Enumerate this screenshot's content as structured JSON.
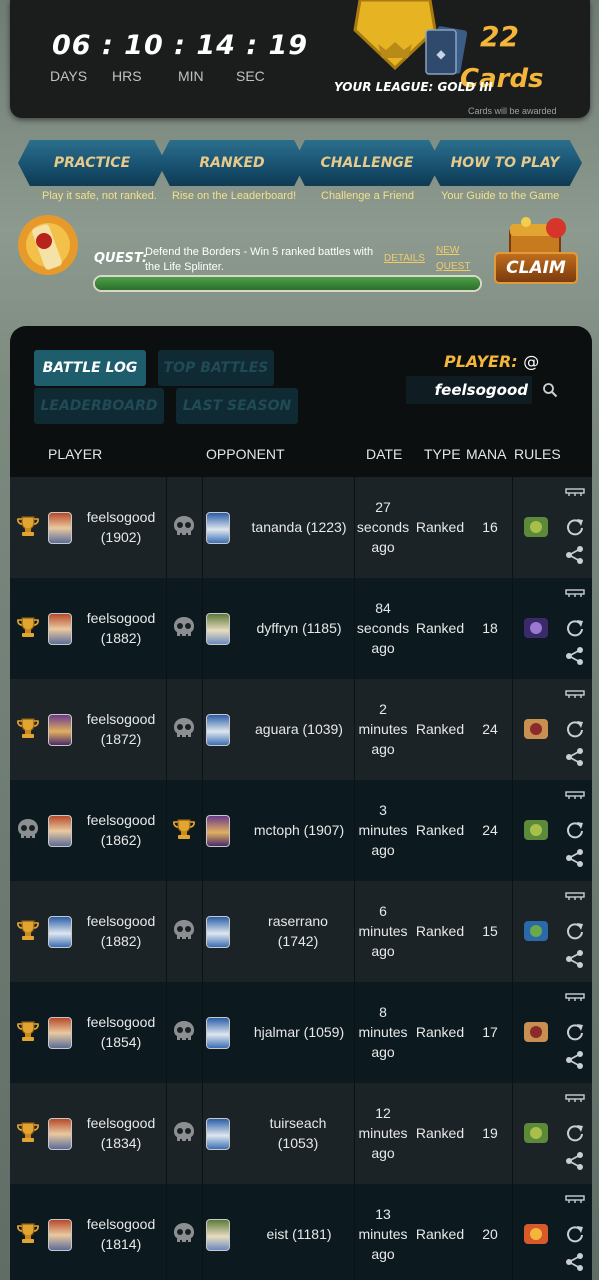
{
  "timer": {
    "digits": "06 : 10 : 14 : 19",
    "days": "DAYS",
    "hrs": "HRS",
    "min": "MIN",
    "sec": "SEC"
  },
  "league": {
    "label": "YOUR LEAGUE: GOLD III",
    "cards_count": "22",
    "cards_word": "Cards",
    "note": "Cards will be awarded"
  },
  "nav": [
    {
      "label": "PRACTICE",
      "sub": "Play it safe, not ranked."
    },
    {
      "label": "RANKED",
      "sub": "Rise on the Leaderboard!"
    },
    {
      "label": "CHALLENGE",
      "sub": "Challenge a Friend"
    },
    {
      "label": "HOW TO PLAY",
      "sub": "Your Guide to the Game"
    }
  ],
  "quest": {
    "title": "QUEST:",
    "desc": "Defend the Borders - Win 5 ranked battles with the Life Splinter.",
    "details": "DETAILS",
    "new": "NEW",
    "quest_word": "QUEST",
    "claim": "CLAIM",
    "progress": 1.0
  },
  "tabs": {
    "battle_log": "BATTLE LOG",
    "top_battles": "TOP BATTLES",
    "leaderboard": "LEADERBOARD",
    "last_season": "LAST SEASON"
  },
  "player_search": {
    "label": "PLAYER:",
    "at": "@",
    "value": "feelsogood"
  },
  "columns": {
    "player": "PLAYER",
    "opponent": "OPPONENT",
    "date": "DATE",
    "type": "TYPE",
    "mana": "MANA",
    "rules": "RULES"
  },
  "rows": [
    {
      "player": "feelsogood",
      "p_rating": "(1902)",
      "opponent": "tananda (1223)",
      "d1": "27",
      "d2": "seconds",
      "d3": "ago",
      "type": "Ranked",
      "mana": "16",
      "player_won": true
    },
    {
      "player": "feelsogood",
      "p_rating": "(1882)",
      "opponent": "dyffryn (1185)",
      "d1": "84",
      "d2": "seconds",
      "d3": "ago",
      "type": "Ranked",
      "mana": "18",
      "player_won": true
    },
    {
      "player": "feelsogood",
      "p_rating": "(1872)",
      "opponent": "aguara (1039)",
      "d1": "2",
      "d2": "minutes",
      "d3": "ago",
      "type": "Ranked",
      "mana": "24",
      "player_won": true
    },
    {
      "player": "feelsogood",
      "p_rating": "(1862)",
      "opponent": "mctoph (1907)",
      "d1": "3",
      "d2": "minutes",
      "d3": "ago",
      "type": "Ranked",
      "mana": "24",
      "player_won": false
    },
    {
      "player": "feelsogood",
      "p_rating": "(1882)",
      "opponent": "raserrano\n(1742)",
      "d1": "6",
      "d2": "minutes",
      "d3": "ago",
      "type": "Ranked",
      "mana": "15",
      "player_won": true
    },
    {
      "player": "feelsogood",
      "p_rating": "(1854)",
      "opponent": "hjalmar (1059)",
      "d1": "8",
      "d2": "minutes",
      "d3": "ago",
      "type": "Ranked",
      "mana": "17",
      "player_won": true
    },
    {
      "player": "feelsogood",
      "p_rating": "(1834)",
      "opponent": "tuirseach\n(1053)",
      "d1": "12",
      "d2": "minutes",
      "d3": "ago",
      "type": "Ranked",
      "mana": "19",
      "player_won": true
    },
    {
      "player": "feelsogood",
      "p_rating": "(1814)",
      "opponent": "eist (1181)",
      "d1": "13",
      "d2": "minutes",
      "d3": "ago",
      "type": "Ranked",
      "mana": "20",
      "player_won": true
    }
  ],
  "colors": {
    "accent": "#f4b63a",
    "tab_active": "#1d5d6c",
    "quest_fill": "#4fa04a"
  }
}
